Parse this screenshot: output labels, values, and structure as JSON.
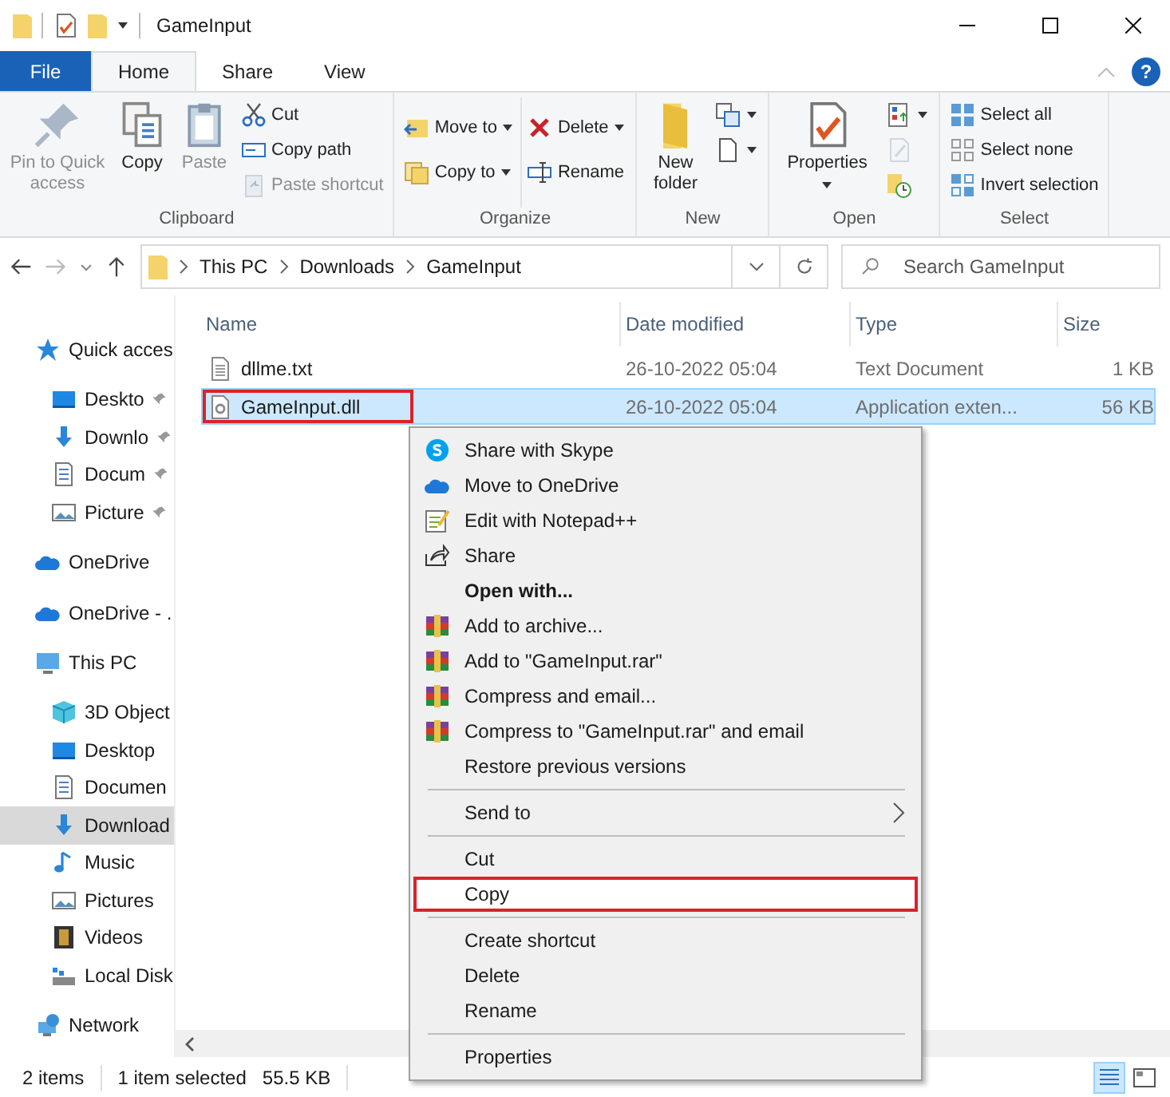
{
  "window": {
    "title": "GameInput"
  },
  "ribbon_tabs": [
    {
      "label": "File",
      "kind": "file",
      "selected": false
    },
    {
      "label": "Home",
      "kind": "tab",
      "selected": true
    },
    {
      "label": "Share",
      "kind": "tab",
      "selected": false
    },
    {
      "label": "View",
      "kind": "tab",
      "selected": false
    }
  ],
  "help": "?",
  "ribbon_groups": [
    {
      "label": "Clipboard",
      "buttons": [
        {
          "label": "Pin to Quick access",
          "kind": "pin",
          "disabled": true
        },
        {
          "label": "Copy",
          "kind": "copy",
          "disabled": false
        },
        {
          "label": "Paste",
          "kind": "paste",
          "disabled": true
        },
        {
          "label": "Cut",
          "kind": "cut",
          "disabled": false
        },
        {
          "label": "Copy path",
          "kind": "copypath",
          "disabled": false
        },
        {
          "label": "Paste shortcut",
          "kind": "pasteshortcut",
          "disabled": true
        }
      ]
    },
    {
      "label": "Organize",
      "buttons": [
        {
          "label": "Move to",
          "kind": "moveto",
          "disabled": false,
          "dropdown": true
        },
        {
          "label": "Copy to",
          "kind": "copyto",
          "disabled": false,
          "dropdown": true
        },
        {
          "label": "Delete",
          "kind": "delete",
          "disabled": false,
          "dropdown": true
        },
        {
          "label": "Rename",
          "kind": "rename",
          "disabled": false,
          "dropdown": false
        }
      ]
    },
    {
      "label": "New",
      "buttons": [
        {
          "label": "New folder",
          "kind": "newfolder",
          "disabled": false
        },
        {
          "kind": "newitem",
          "disabled": false,
          "dropdown": true
        },
        {
          "kind": "easyaccess",
          "disabled": false,
          "dropdown": true
        }
      ]
    },
    {
      "label": "Open",
      "buttons": [
        {
          "label": "Properties",
          "kind": "properties",
          "disabled": false,
          "dropdown": true
        },
        {
          "kind": "open",
          "disabled": false,
          "dropdown": true
        },
        {
          "kind": "edit",
          "disabled": true
        },
        {
          "kind": "history",
          "disabled": false
        }
      ]
    },
    {
      "label": "Select",
      "buttons": [
        {
          "label": "Select all",
          "kind": "selectall",
          "disabled": false
        },
        {
          "label": "Select none",
          "kind": "selectnone",
          "disabled": false
        },
        {
          "label": "Invert selection",
          "kind": "invert",
          "disabled": false
        }
      ]
    }
  ],
  "address": {
    "crumbs": [
      "This PC",
      "Downloads",
      "GameInput"
    ]
  },
  "search": {
    "placeholder": "Search GameInput"
  },
  "sidebar": [
    {
      "label": "Quick acces",
      "kind": "star",
      "selected": false,
      "children": [
        {
          "label": "Deskto",
          "kind": "desktop",
          "selected": false,
          "pinned": true
        },
        {
          "label": "Downlo",
          "kind": "download",
          "selected": false,
          "pinned": true
        },
        {
          "label": "Docum",
          "kind": "document",
          "selected": false,
          "pinned": true
        },
        {
          "label": "Picture",
          "kind": "pictures",
          "selected": false,
          "pinned": true
        }
      ]
    },
    {
      "label": "OneDrive",
      "kind": "cloud",
      "selected": false
    },
    {
      "label": "OneDrive - .",
      "kind": "cloud",
      "selected": false
    },
    {
      "label": "This PC",
      "kind": "pc",
      "selected": false,
      "children": [
        {
          "label": "3D Object",
          "kind": "cube",
          "selected": false
        },
        {
          "label": "Desktop",
          "kind": "desktop",
          "selected": false
        },
        {
          "label": "Documen",
          "kind": "document",
          "selected": false
        },
        {
          "label": "Download",
          "kind": "download",
          "selected": true
        },
        {
          "label": "Music",
          "kind": "music",
          "selected": false
        },
        {
          "label": "Pictures",
          "kind": "pictures",
          "selected": false
        },
        {
          "label": "Videos",
          "kind": "video",
          "selected": false
        },
        {
          "label": "Local Disk",
          "kind": "disk",
          "selected": false
        }
      ]
    },
    {
      "label": "Network",
      "kind": "network",
      "selected": false
    }
  ],
  "table": {
    "columns": [
      "Name",
      "Date modified",
      "Type",
      "Size"
    ],
    "rows": [
      {
        "name": "dllme.txt",
        "date": "26-10-2022 05:04",
        "type": "Text Document",
        "size": "1 KB",
        "kind": "text",
        "selected": false,
        "highlighted": false
      },
      {
        "name": "GameInput.dll",
        "date": "26-10-2022 05:04",
        "type": "Application exten...",
        "size": "56 KB",
        "kind": "dll",
        "selected": true,
        "highlighted": true
      }
    ]
  },
  "context_menu": [
    [
      {
        "label": "Share with Skype",
        "kind": "skype"
      },
      {
        "label": "Move to OneDrive",
        "kind": "cloud"
      },
      {
        "label": "Edit with Notepad++",
        "kind": "notepad"
      },
      {
        "label": "Share",
        "kind": "share"
      },
      {
        "label": "Open with...",
        "kind": "plain",
        "bold": true
      },
      {
        "label": "Add to archive...",
        "kind": "winrar"
      },
      {
        "label": "Add to \"GameInput.rar\"",
        "kind": "winrar"
      },
      {
        "label": "Compress and email...",
        "kind": "winrar"
      },
      {
        "label": "Compress to \"GameInput.rar\" and email",
        "kind": "winrar"
      },
      {
        "label": "Restore previous versions",
        "kind": "plain"
      }
    ],
    [
      {
        "label": "Send to",
        "kind": "plain",
        "submenu": true
      }
    ],
    [
      {
        "label": "Cut",
        "kind": "plain"
      },
      {
        "label": "Copy",
        "kind": "plain",
        "highlighted": true
      }
    ],
    [
      {
        "label": "Create shortcut",
        "kind": "plain"
      },
      {
        "label": "Delete",
        "kind": "plain"
      },
      {
        "label": "Rename",
        "kind": "plain"
      }
    ],
    [
      {
        "label": "Properties",
        "kind": "plain"
      }
    ]
  ],
  "status_bar": {
    "count": "2 items",
    "selection": "1 item selected",
    "size": "55.5 KB",
    "views": [
      {
        "kind": "details",
        "selected": true
      },
      {
        "kind": "tiles",
        "selected": false
      }
    ]
  }
}
